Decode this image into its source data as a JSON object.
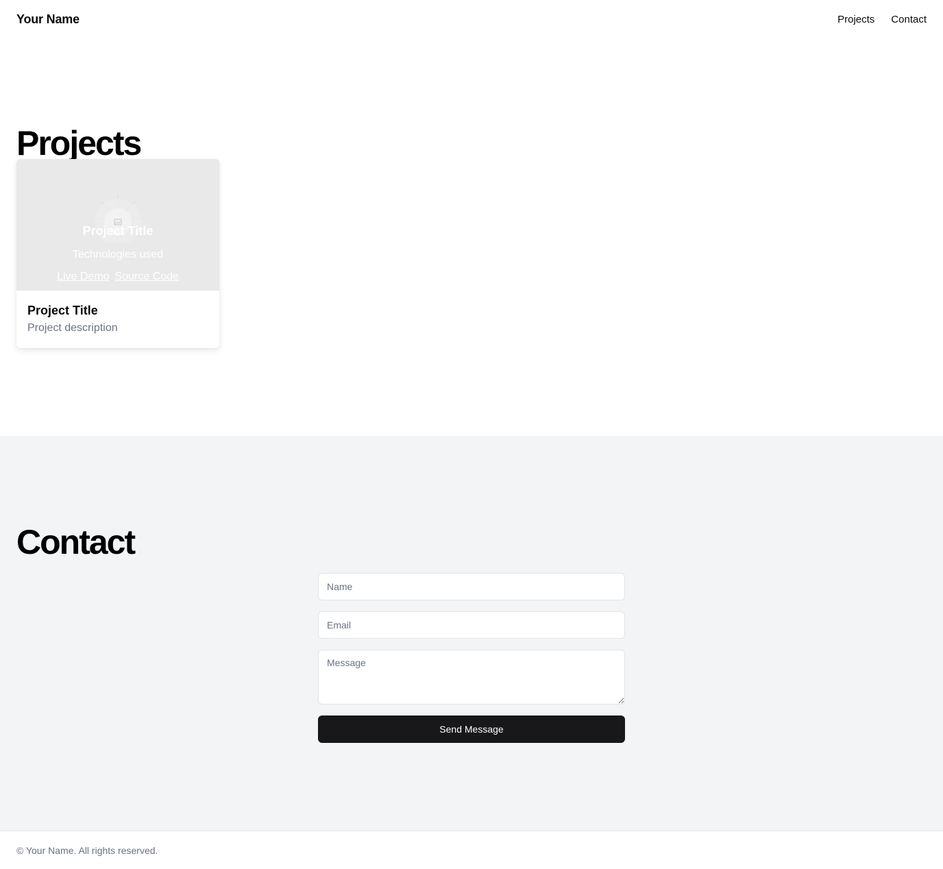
{
  "header": {
    "brand": "Your Name",
    "nav": [
      {
        "label": "Projects"
      },
      {
        "label": "Contact"
      }
    ]
  },
  "projects": {
    "heading": "Projects",
    "cards": [
      {
        "overlay_title": "Project Title",
        "overlay_tech": "Technologies used",
        "live_demo_label": "Live Demo",
        "source_code_label": "Source Code",
        "title": "Project Title",
        "description": "Project description",
        "image_icon": "image-placeholder-icon"
      }
    ]
  },
  "contact": {
    "heading": "Contact",
    "name_placeholder": "Name",
    "email_placeholder": "Email",
    "message_placeholder": "Message",
    "submit_label": "Send Message"
  },
  "footer": {
    "copyright": "© Your Name. All rights reserved."
  },
  "colors": {
    "button_bg": "#18181b",
    "contact_bg": "#f3f4f6",
    "muted_text": "#6b7280",
    "card_media_bg": "#e9e9e9"
  }
}
